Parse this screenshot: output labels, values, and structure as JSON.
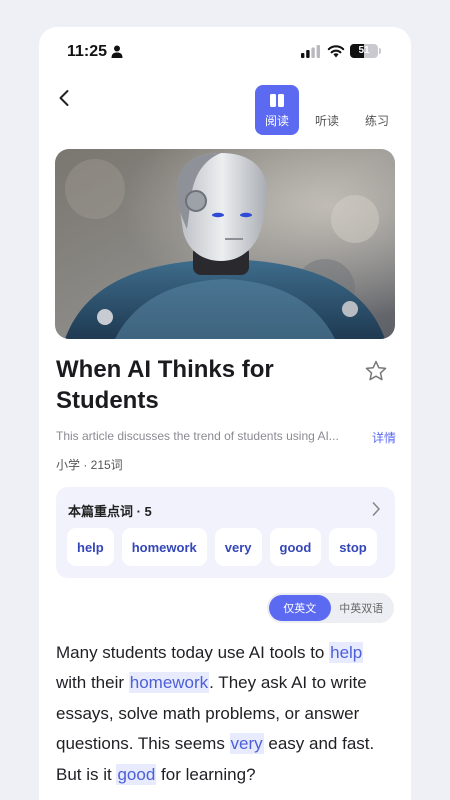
{
  "status_bar": {
    "time": "11:25",
    "battery": "51"
  },
  "tabs": [
    {
      "label": "阅读",
      "icon": "book-icon",
      "active": true
    },
    {
      "label": "听读",
      "active": false
    },
    {
      "label": "练习",
      "active": false
    }
  ],
  "article": {
    "title": "When AI Thinks for Students",
    "summary": "This article discusses the trend of students using AI...",
    "detail_label": "详情",
    "meta": "小学 · 215词"
  },
  "vocab": {
    "title": "本篇重点词 · 5",
    "words": [
      "help",
      "homework",
      "very",
      "good",
      "stop"
    ]
  },
  "language_toggle": {
    "english_only": "仅英文",
    "bilingual": "中英双语",
    "selected": "english_only"
  },
  "body": {
    "s1": "Many students today use AI tools to ",
    "w1": "help",
    "s2": " with their ",
    "w2": "homework",
    "s3": ". They ask AI to write essays, solve math problems, or answer questions. This seems ",
    "w3": "very",
    "s4": " easy and fast. But is it ",
    "w4": "good",
    "s5": " for learning?"
  },
  "colors": {
    "accent": "#5b6af0",
    "highlight_bg": "#e7ebfd",
    "highlight_text": "#4c5fd8"
  }
}
